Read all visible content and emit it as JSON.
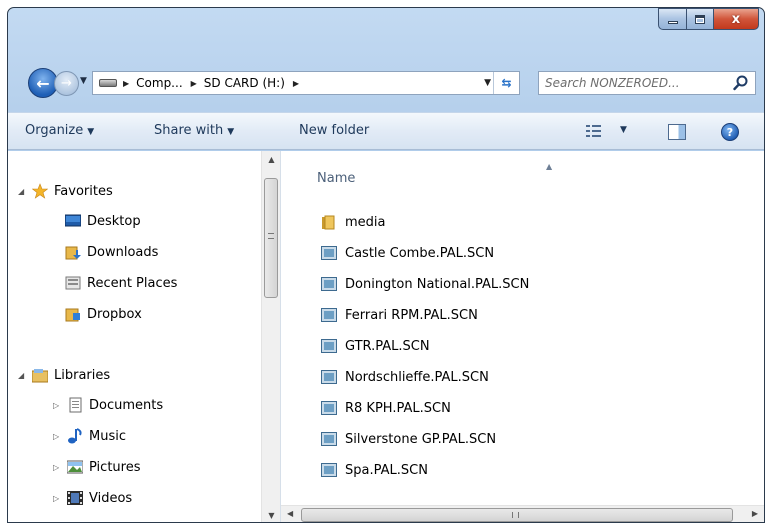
{
  "window": {
    "caption": {
      "minimize": "–",
      "maximize": "□",
      "close": "x"
    }
  },
  "address_bar": {
    "crumbs": [
      "Comp...",
      "SD CARD (H:)"
    ],
    "search_placeholder": "Search NONZEROED..."
  },
  "command_bar": {
    "organize": "Organize",
    "share_with": "Share with",
    "new_folder": "New folder",
    "help": "?"
  },
  "nav_pane": {
    "favorites": {
      "label": "Favorites",
      "items": [
        "Desktop",
        "Downloads",
        "Recent Places",
        "Dropbox"
      ]
    },
    "libraries": {
      "label": "Libraries",
      "items": [
        "Documents",
        "Music",
        "Pictures",
        "Videos"
      ]
    }
  },
  "file_list": {
    "column_header": "Name",
    "items": [
      {
        "name": "media",
        "type": "folder"
      },
      {
        "name": "Castle Combe.PAL.SCN",
        "type": "file"
      },
      {
        "name": "Donington National.PAL.SCN",
        "type": "file"
      },
      {
        "name": "Ferrari RPM.PAL.SCN",
        "type": "file"
      },
      {
        "name": "GTR.PAL.SCN",
        "type": "file"
      },
      {
        "name": "Nordschlieffe.PAL.SCN",
        "type": "file"
      },
      {
        "name": "R8 KPH.PAL.SCN",
        "type": "file"
      },
      {
        "name": "Silverstone GP.PAL.SCN",
        "type": "file"
      },
      {
        "name": "Spa.PAL.SCN",
        "type": "file"
      }
    ]
  },
  "colors": {
    "frame": "#a8c6e6",
    "command_bar_text": "#1e395b",
    "close_button": "#c2391d"
  }
}
